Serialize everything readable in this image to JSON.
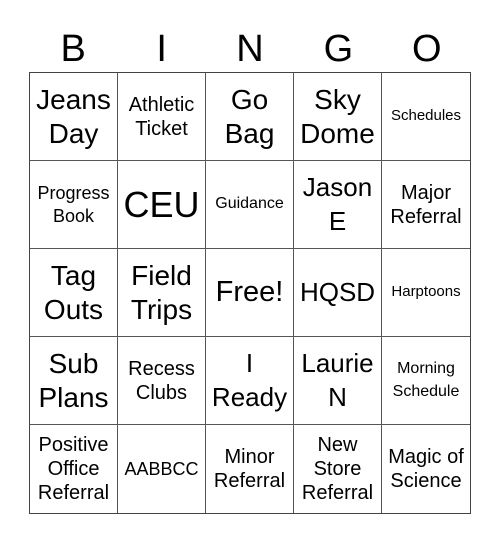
{
  "header": [
    "B",
    "I",
    "N",
    "G",
    "O"
  ],
  "cells": [
    {
      "text": "Jeans Day",
      "size": "s28"
    },
    {
      "text": "Athletic Ticket",
      "size": "s20"
    },
    {
      "text": "Go Bag",
      "size": "s28"
    },
    {
      "text": "Sky Dome",
      "size": "s28"
    },
    {
      "text": "Schedules",
      "size": "s15"
    },
    {
      "text": "Progress Book",
      "size": "s18"
    },
    {
      "text": "CEU",
      "size": "s36"
    },
    {
      "text": "Guidance",
      "size": "s16"
    },
    {
      "text": "Jason E",
      "size": "s26"
    },
    {
      "text": "Major Referral",
      "size": "s20"
    },
    {
      "text": "Tag Outs",
      "size": "s28"
    },
    {
      "text": "Field Trips",
      "size": "s28"
    },
    {
      "text": "Free!",
      "size": "s29"
    },
    {
      "text": "HQSD",
      "size": "s26"
    },
    {
      "text": "Harptoons",
      "size": "s15"
    },
    {
      "text": "Sub Plans",
      "size": "s28"
    },
    {
      "text": "Recess Clubs",
      "size": "s20"
    },
    {
      "text": "I Ready",
      "size": "s26"
    },
    {
      "text": "Laurie N",
      "size": "s26"
    },
    {
      "text": "Morning Schedule",
      "size": "s16"
    },
    {
      "text": "Positive Office Referral",
      "size": "s20"
    },
    {
      "text": "AABBCC",
      "size": "s18"
    },
    {
      "text": "Minor Referral",
      "size": "s20"
    },
    {
      "text": "New Store Referral",
      "size": "s20"
    },
    {
      "text": "Magic of Science",
      "size": "s20"
    }
  ]
}
